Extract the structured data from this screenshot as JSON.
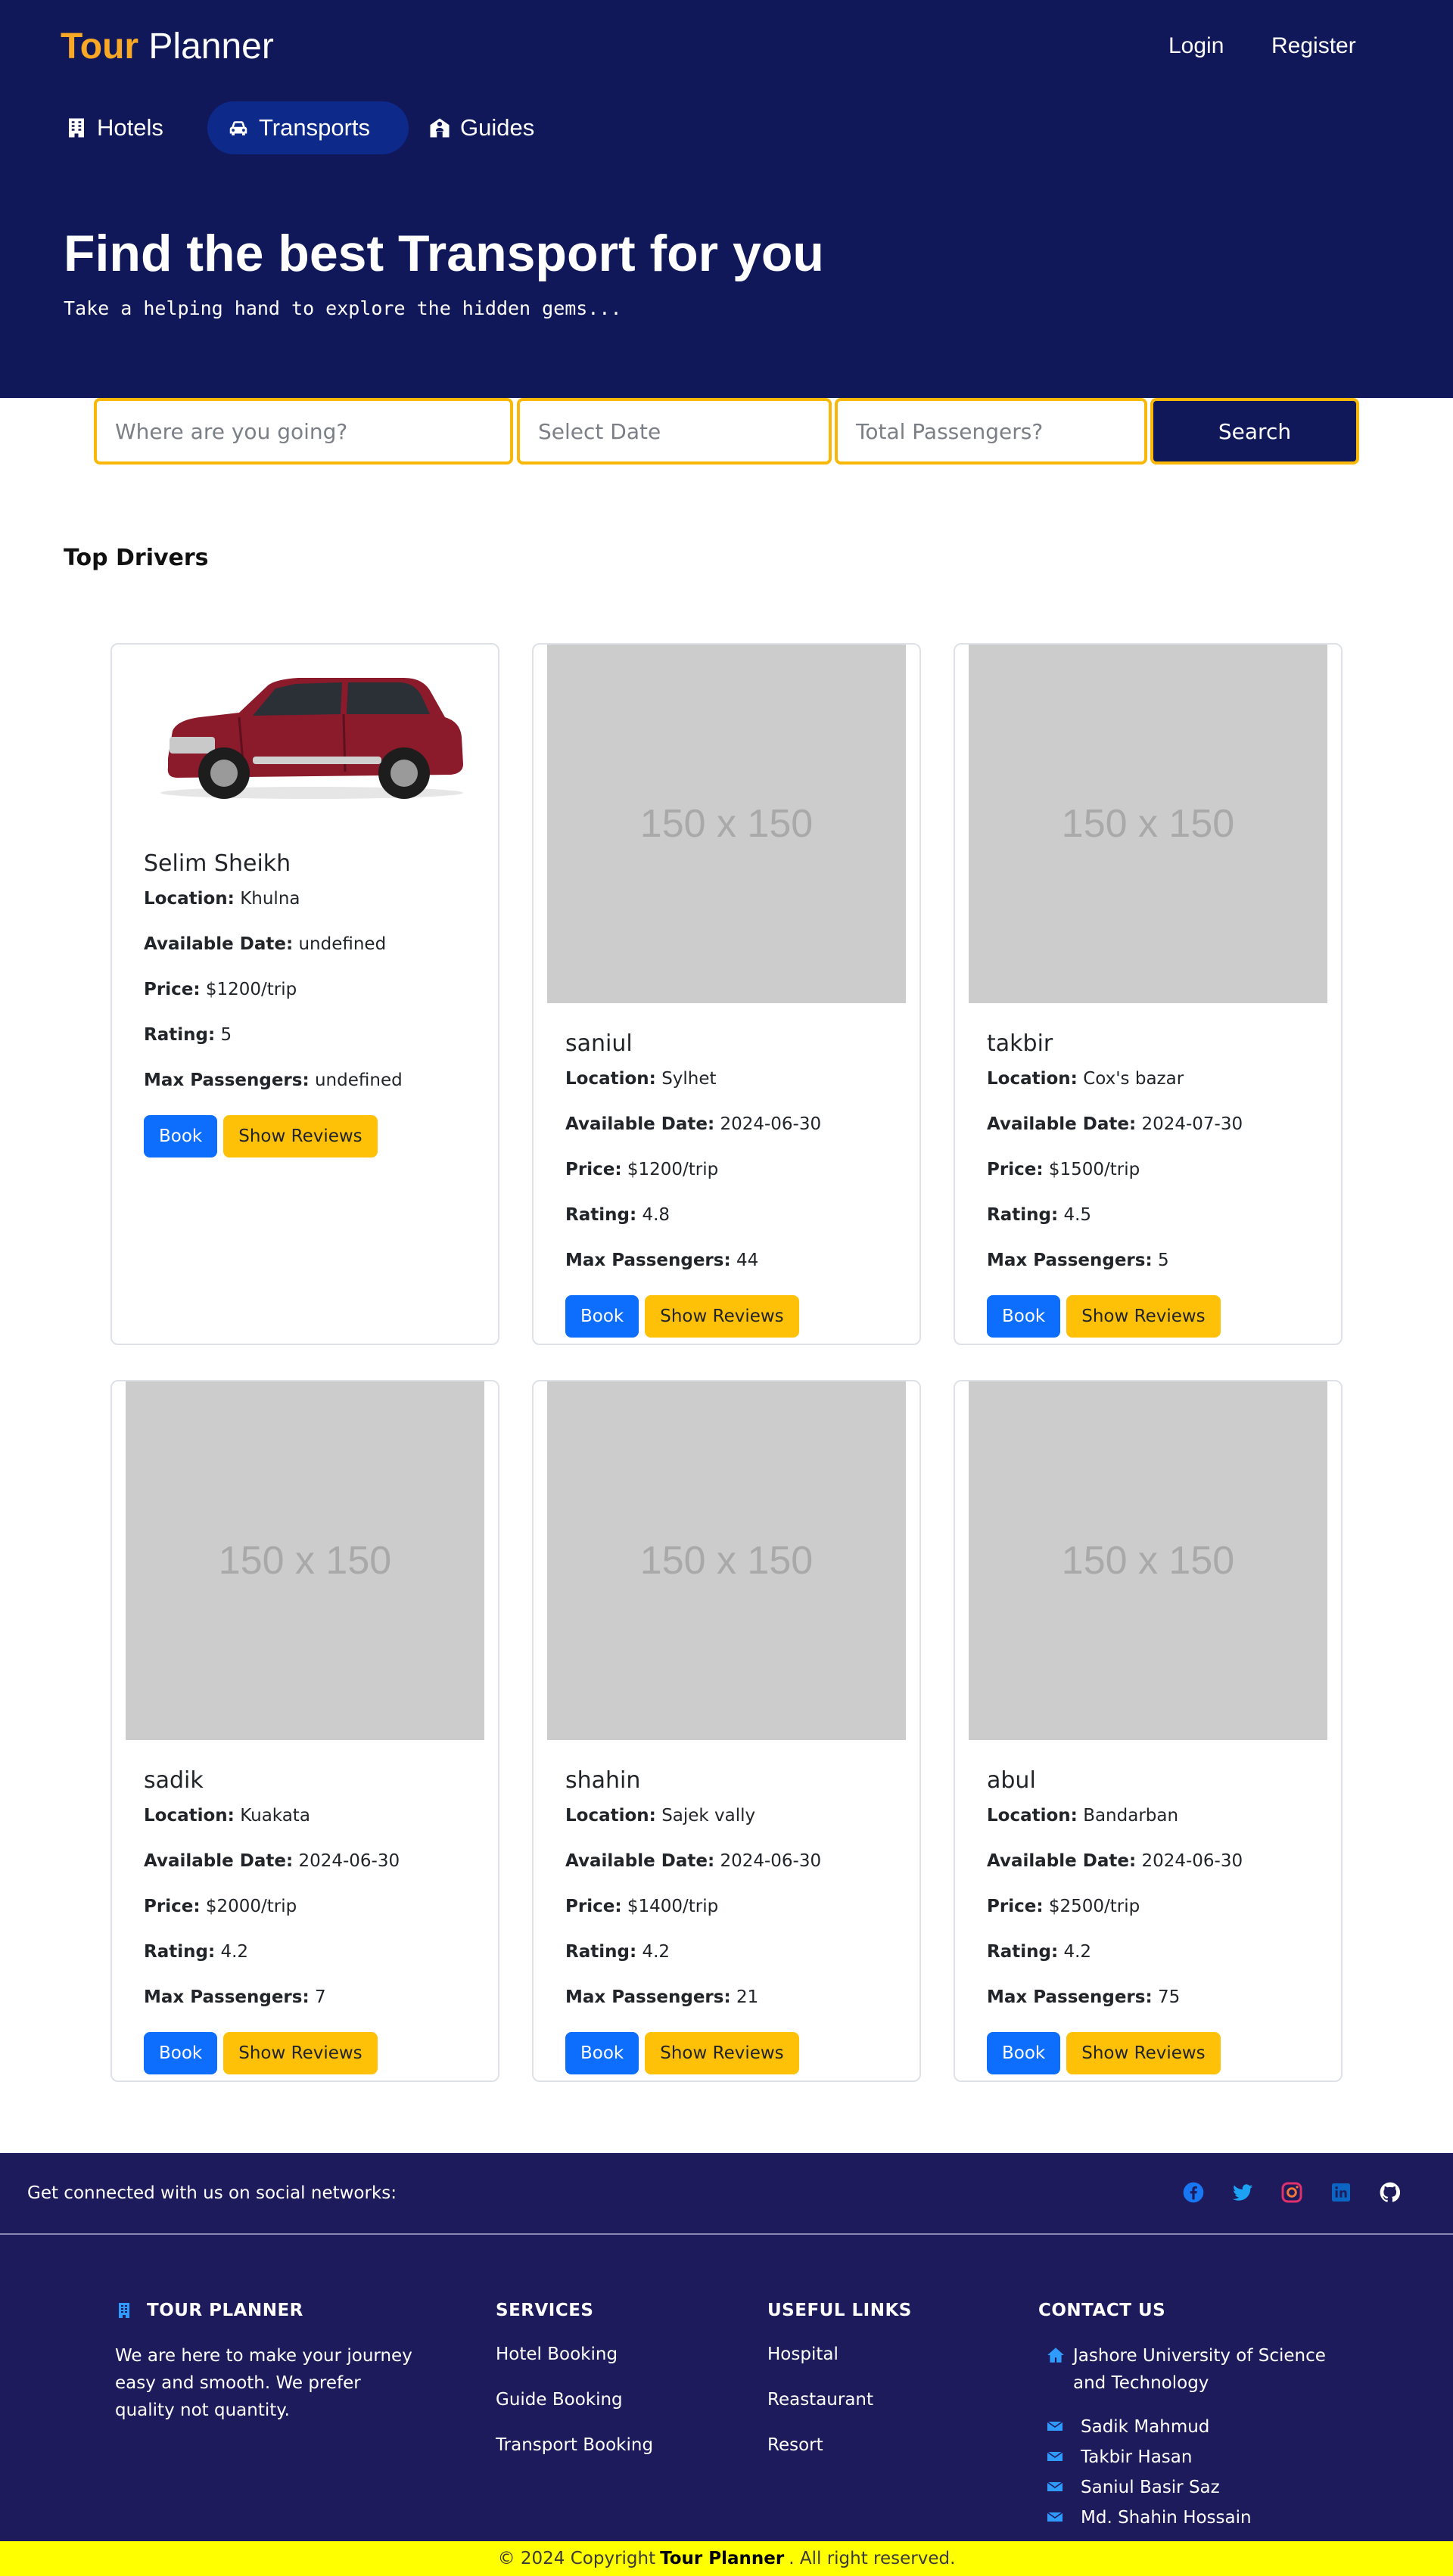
{
  "brand": {
    "accent": "Tour",
    "rest": " Planner"
  },
  "auth": {
    "login": "Login",
    "register": "Register"
  },
  "nav": {
    "hotels": "Hotels",
    "transports": "Transports",
    "guides": "Guides"
  },
  "hero": {
    "title": "Find the best Transport for you",
    "subtitle": "Take a helping hand to explore the hidden gems..."
  },
  "search": {
    "where_placeholder": "Where are you going?",
    "date_placeholder": "Select Date",
    "passengers_placeholder": "Total Passengers?",
    "button": "Search"
  },
  "section_title": "Top Drivers",
  "labels": {
    "location": "Location:",
    "date": "Available Date:",
    "price": "Price:",
    "rating": "Rating:",
    "max": "Max Passengers:",
    "book": "Book",
    "reviews": "Show Reviews",
    "placeholder_image": "150 x 150"
  },
  "drivers": [
    {
      "name": "Selim Sheikh",
      "location": "Khulna",
      "date": "undefined",
      "price": "$1200/trip",
      "rating": "5",
      "max": "undefined"
    },
    {
      "name": "saniul",
      "location": "Sylhet",
      "date": "2024-06-30",
      "price": "$1200/trip",
      "rating": "4.8",
      "max": "44"
    },
    {
      "name": "takbir",
      "location": "Cox's bazar",
      "date": "2024-07-30",
      "price": "$1500/trip",
      "rating": "4.5",
      "max": "5"
    },
    {
      "name": "sadik",
      "location": "Kuakata",
      "date": "2024-06-30",
      "price": "$2000/trip",
      "rating": "4.2",
      "max": "7"
    },
    {
      "name": "shahin",
      "location": "Sajek vally",
      "date": "2024-06-30",
      "price": "$1400/trip",
      "rating": "4.2",
      "max": "21"
    },
    {
      "name": "abul",
      "location": "Bandarban",
      "date": "2024-06-30",
      "price": "$2500/trip",
      "rating": "4.2",
      "max": "75"
    }
  ],
  "footer": {
    "social_text": "Get connected with us on social networks:",
    "social_icons": [
      "facebook-icon",
      "twitter-icon",
      "instagram-icon",
      "linkedin-icon",
      "github-icon"
    ],
    "about_title": "TOUR PLANNER",
    "about_text": "We are here to make your journey easy and smooth. We prefer quality not quantity.",
    "services_title": "SERVICES",
    "services": [
      "Hotel Booking",
      "Guide Booking",
      "Transport Booking"
    ],
    "links_title": "USEFUL LINKS",
    "links": [
      "Hospital",
      "Reastaurant",
      "Resort"
    ],
    "contact_title": "CONTACT US",
    "address": "Jashore University of Science and Technology",
    "contacts": [
      "Sadik Mahmud",
      "Takbir Hasan",
      "Saniul Basir Saz",
      "Md. Shahin Hossain"
    ]
  },
  "copyright": {
    "prefix": "© 2024 Copyright",
    "brand": "Tour Planner",
    "suffix": ". All right reserved."
  },
  "colors": {
    "navy": "#10185a",
    "accent": "#f9a825",
    "primary": "#0d6efd",
    "warning": "#ffc107",
    "footer": "#1e1b5d",
    "copyright_bg": "#ffff00"
  }
}
